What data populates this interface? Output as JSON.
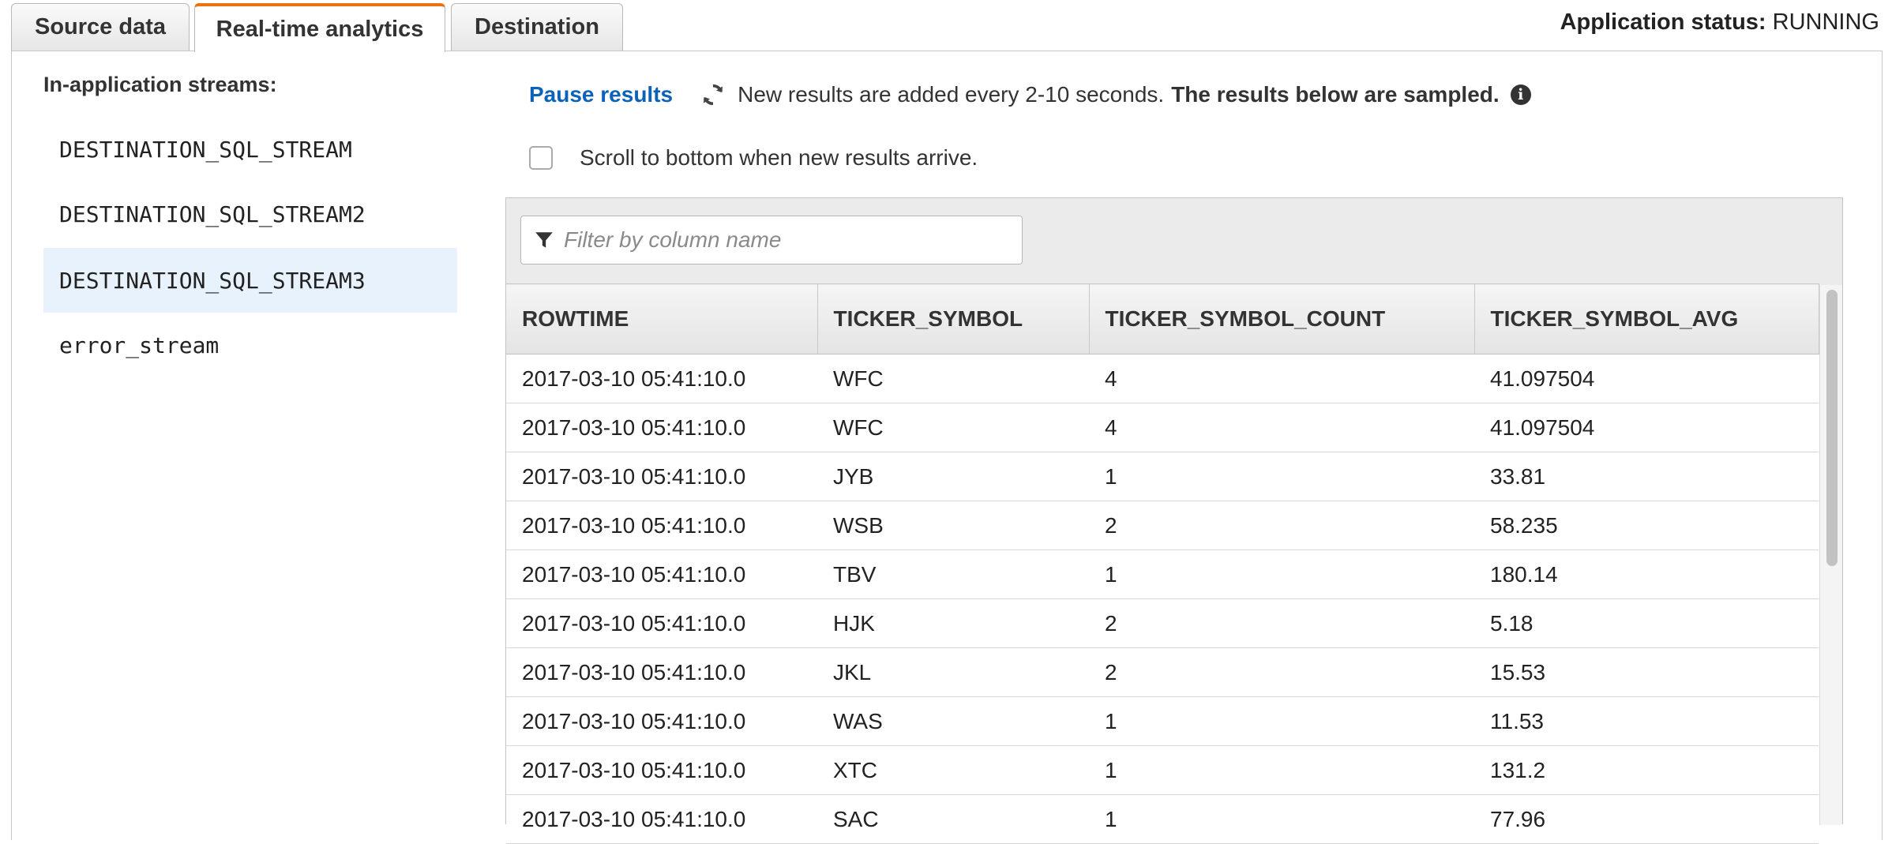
{
  "header": {
    "tabs": [
      {
        "label": "Source data",
        "active": false
      },
      {
        "label": "Real-time analytics",
        "active": true
      },
      {
        "label": "Destination",
        "active": false
      }
    ],
    "status_label": "Application status:",
    "status_value": "RUNNING"
  },
  "sidebar": {
    "heading": "In-application streams:",
    "items": [
      {
        "label": "DESTINATION_SQL_STREAM",
        "selected": false
      },
      {
        "label": "DESTINATION_SQL_STREAM2",
        "selected": false
      },
      {
        "label": "DESTINATION_SQL_STREAM3",
        "selected": true
      },
      {
        "label": "error_stream",
        "selected": false
      }
    ]
  },
  "toolbar": {
    "pause_label": "Pause results",
    "info_text": "New results are added every 2-10 seconds.",
    "info_bold": "The results below are sampled.",
    "scroll_label": "Scroll to bottom when new results arrive.",
    "scroll_checked": false
  },
  "filter": {
    "placeholder": "Filter by column name",
    "value": ""
  },
  "table": {
    "columns": [
      "ROWTIME",
      "TICKER_SYMBOL",
      "TICKER_SYMBOL_COUNT",
      "TICKER_SYMBOL_AVG"
    ],
    "rows": [
      [
        "2017-03-10 05:41:10.0",
        "WFC",
        "4",
        "41.097504"
      ],
      [
        "2017-03-10 05:41:10.0",
        "WFC",
        "4",
        "41.097504"
      ],
      [
        "2017-03-10 05:41:10.0",
        "JYB",
        "1",
        "33.81"
      ],
      [
        "2017-03-10 05:41:10.0",
        "WSB",
        "2",
        "58.235"
      ],
      [
        "2017-03-10 05:41:10.0",
        "TBV",
        "1",
        "180.14"
      ],
      [
        "2017-03-10 05:41:10.0",
        "HJK",
        "2",
        "5.18"
      ],
      [
        "2017-03-10 05:41:10.0",
        "JKL",
        "2",
        "15.53"
      ],
      [
        "2017-03-10 05:41:10.0",
        "WAS",
        "1",
        "11.53"
      ],
      [
        "2017-03-10 05:41:10.0",
        "XTC",
        "1",
        "131.2"
      ],
      [
        "2017-03-10 05:41:10.0",
        "SAC",
        "1",
        "77.96"
      ]
    ]
  },
  "colors": {
    "accent_tab": "#ec7211",
    "link": "#0b62b8",
    "selected_bg": "#e7f2fd"
  }
}
